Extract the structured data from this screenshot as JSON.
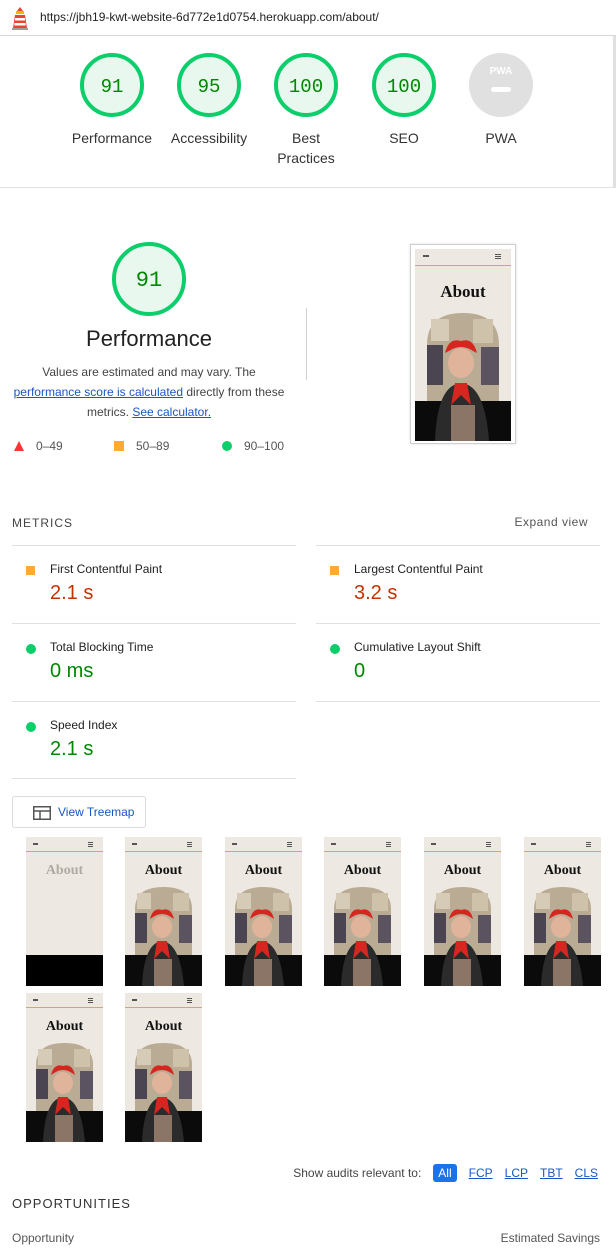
{
  "browser": {
    "url": "https://jbh19-kwt-website-6d772e1d0754.herokuapp.com/about/"
  },
  "categories": [
    {
      "label": "Performance",
      "score": "91",
      "color": "#0cce6b"
    },
    {
      "label": "Accessibility",
      "score": "95",
      "color": "#0cce6b"
    },
    {
      "label": "Best Practices",
      "score": "100",
      "color": "#0cce6b"
    },
    {
      "label": "SEO",
      "score": "100",
      "color": "#0cce6b"
    },
    {
      "label": "PWA",
      "score": "PWA",
      "color": "#cccccc"
    }
  ],
  "performance": {
    "score": "91",
    "title": "Performance",
    "desc_1": "Values are estimated and may vary. The",
    "desc_link1": "performance score is calculated",
    "desc_2": " directly from these metrics.",
    "desc_link2": "See calculator.",
    "legend": {
      "fail": "0–49",
      "average": "50–89",
      "pass": "90–100"
    },
    "colors": {
      "fail": "#ff3333",
      "average": "#ffaa33",
      "pass": "#0cce6b"
    }
  },
  "screenshot": {
    "heading": "About"
  },
  "metrics": {
    "title": "METRICS",
    "expand_label": "Expand view",
    "items": [
      {
        "name": "First Contentful Paint",
        "value": "2.1 s",
        "status": "average"
      },
      {
        "name": "Largest Contentful Paint",
        "value": "3.2 s",
        "status": "average"
      },
      {
        "name": "Total Blocking Time",
        "value": "0 ms",
        "status": "pass"
      },
      {
        "name": "Cumulative Layout Shift",
        "value": "0",
        "status": "pass"
      },
      {
        "name": "Speed Index",
        "value": "2.1 s",
        "status": "pass"
      }
    ]
  },
  "treemap": {
    "label": "View Treemap"
  },
  "filmstrip": {
    "heading": "About",
    "frames": 8
  },
  "filter": {
    "label": "Show audits relevant to:",
    "chips": [
      "All",
      "FCP",
      "LCP",
      "TBT",
      "CLS"
    ],
    "active": "All"
  },
  "opportunities": {
    "title": "OPPORTUNITIES",
    "col_opportunity": "Opportunity",
    "col_savings": "Estimated Savings"
  }
}
